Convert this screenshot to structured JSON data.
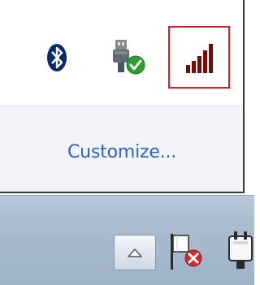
{
  "overflow_panel": {
    "icons": [
      {
        "name": "bluetooth-icon"
      },
      {
        "name": "safely-remove-hardware-icon"
      },
      {
        "name": "network-signal-icon",
        "highlighted": true
      }
    ],
    "customize_label": "Customize..."
  },
  "taskbar": {
    "icons": [
      {
        "name": "show-hidden-icons-button"
      },
      {
        "name": "action-center-flag-icon"
      },
      {
        "name": "power-plug-icon"
      }
    ]
  },
  "colors": {
    "link": "#2b63c9",
    "highlight_border": "#e11b1b",
    "signal_bars": "#7a0a0a",
    "bluetooth_bg": "#0a2a6b",
    "taskbar": "#a9bcd0"
  }
}
